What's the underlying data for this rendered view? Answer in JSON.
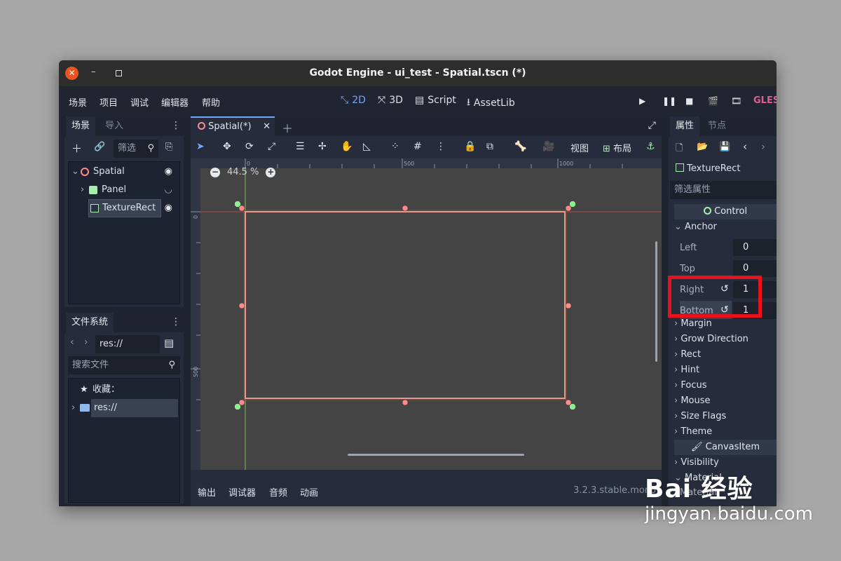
{
  "window": {
    "title": "Godot Engine - ui_test - Spatial.tscn (*)"
  },
  "menu": {
    "items": [
      "场景",
      "项目",
      "调试",
      "编辑器",
      "帮助"
    ]
  },
  "modes": {
    "twod": "2D",
    "threed": "3D",
    "script": "Script",
    "assetlib": "AssetLib"
  },
  "renderer": "GLES",
  "scene_dock": {
    "tabs": [
      "场景",
      "导入"
    ],
    "filter_placeholder": "筛选",
    "nodes": [
      {
        "name": "Spatial",
        "type": "Node"
      },
      {
        "name": "Panel",
        "type": "Panel"
      },
      {
        "name": "TextureRect",
        "type": "TextureRect"
      }
    ]
  },
  "filesystem": {
    "tab": "文件系统",
    "path": "res://",
    "search_placeholder": "搜索文件",
    "favorites": "收藏：",
    "root": "res://"
  },
  "viewport": {
    "scene_tab": "Spatial(*)",
    "zoom": "44.5 %",
    "view_menu": "视图",
    "layout_menu": "布局",
    "ruler_marks": {
      "zero": "0",
      "five_hundred": "500",
      "thousand": "1000"
    }
  },
  "bottom_panel": {
    "items": [
      "输出",
      "调试器",
      "音频",
      "动画"
    ],
    "version": "3.2.3.stable.mono"
  },
  "inspector": {
    "tabs": [
      "属性",
      "节点"
    ],
    "node_name": "TextureRect",
    "filter_placeholder": "筛选属性",
    "section_control": "Control",
    "anchor": "Anchor",
    "props": [
      {
        "label": "Left",
        "value": "0"
      },
      {
        "label": "Top",
        "value": "0"
      },
      {
        "label": "Right",
        "value": "1"
      },
      {
        "label": "Bottom",
        "value": "1"
      }
    ],
    "groups": [
      "Margin",
      "Grow Direction",
      "Rect",
      "Hint",
      "Focus",
      "Mouse",
      "Size Flags",
      "Theme"
    ],
    "section_canvas": "CanvasItem",
    "canvas_groups": [
      "Visibility",
      "Material"
    ],
    "material_prop": "Material"
  },
  "colors": {
    "accent": "#6da7ff",
    "selection": "#e8121c",
    "handle_red": "#ff8080",
    "handle_green": "#90ee90"
  },
  "watermark": {
    "logo": "Bai  经验",
    "url": "jingyan.baidu.com"
  }
}
